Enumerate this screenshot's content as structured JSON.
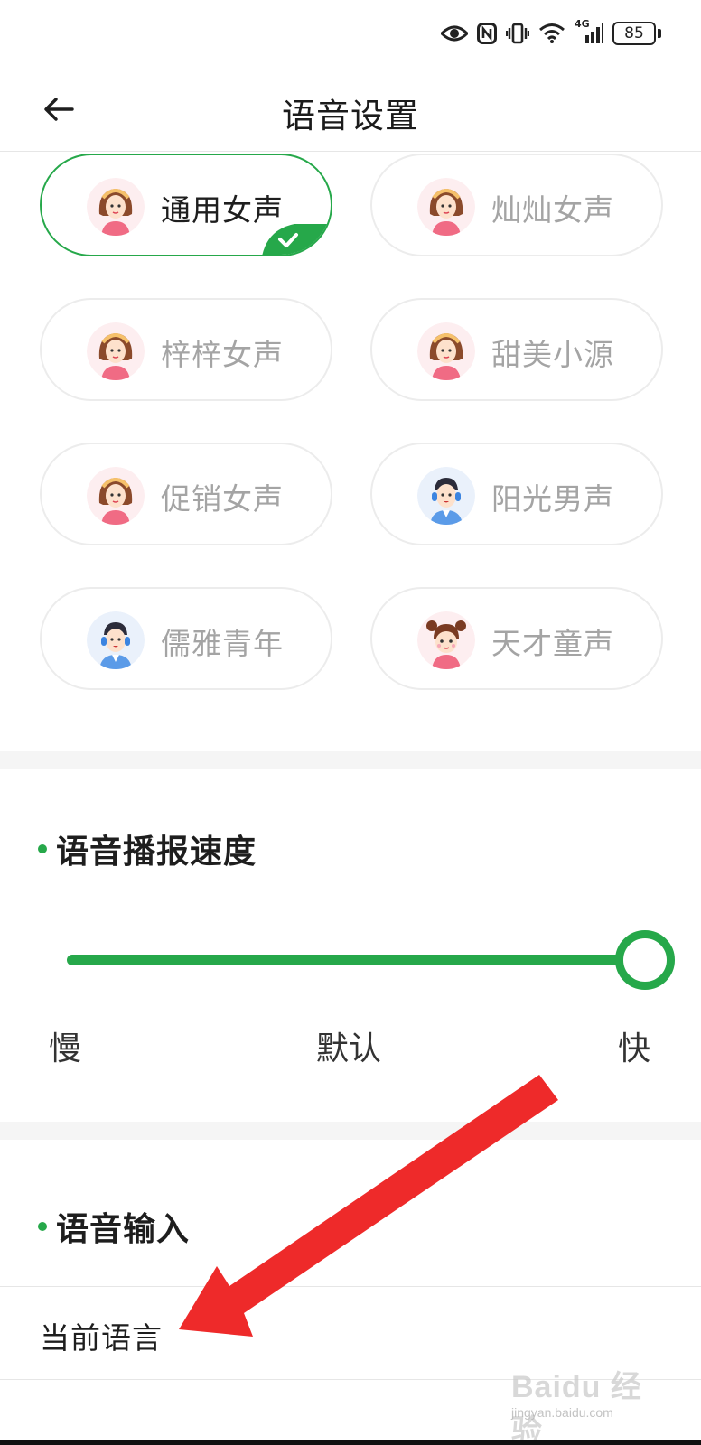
{
  "status_bar": {
    "icons": [
      "eye-icon",
      "nfc-icon",
      "vibrate-icon",
      "wifi-icon",
      "signal-icon"
    ],
    "network_label": "4G",
    "battery": "85"
  },
  "header": {
    "back_icon": "arrow-left-icon",
    "title": "语音设置"
  },
  "voices": [
    {
      "label": "通用女声",
      "avatar": "woman",
      "selected": true
    },
    {
      "label": "灿灿女声",
      "avatar": "woman",
      "selected": false
    },
    {
      "label": "梓梓女声",
      "avatar": "woman",
      "selected": false
    },
    {
      "label": "甜美小源",
      "avatar": "woman",
      "selected": false
    },
    {
      "label": "促销女声",
      "avatar": "woman",
      "selected": false
    },
    {
      "label": "阳光男声",
      "avatar": "man",
      "selected": false
    },
    {
      "label": "儒雅青年",
      "avatar": "man",
      "selected": false
    },
    {
      "label": "天才童声",
      "avatar": "child",
      "selected": false
    }
  ],
  "speed": {
    "heading": "语音播报速度",
    "value_fraction": 1.0,
    "labels": {
      "slow": "慢",
      "default": "默认",
      "fast": "快"
    }
  },
  "voice_input": {
    "heading": "语音输入",
    "current_language_label": "当前语言"
  },
  "watermark": {
    "main": "Baidu 经验",
    "sub": "jingyan.baidu.com"
  },
  "colors": {
    "accent": "#26a84a",
    "annotation_arrow": "#ee2a2a"
  }
}
